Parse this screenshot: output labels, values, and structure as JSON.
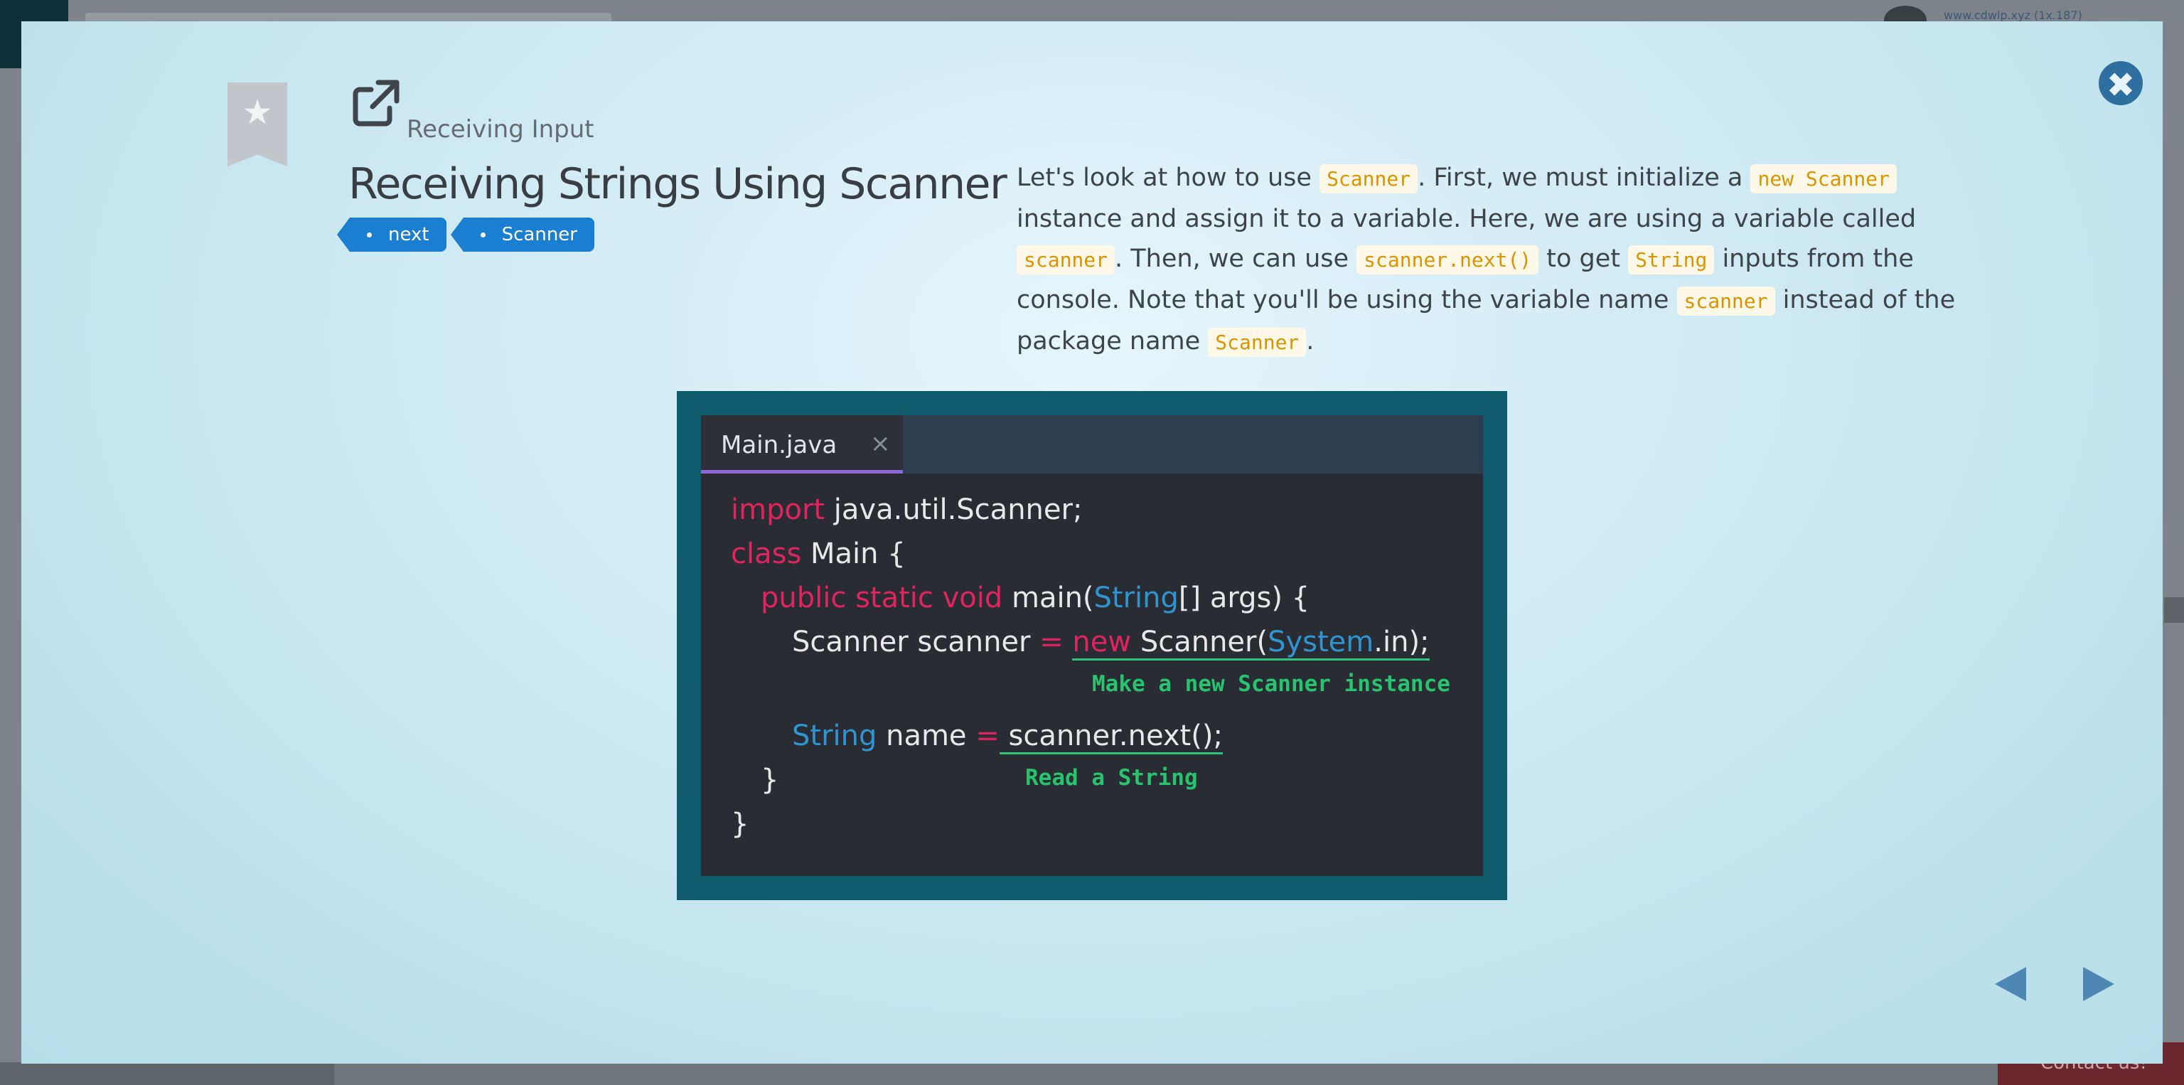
{
  "background": {
    "url_text": "www.cdwlp.xyz (1x.187)",
    "contact_label": "Contact us!"
  },
  "modal": {
    "close_label": "✖",
    "section_title": "Receiving Input",
    "title": "Receiving Strings Using Scanner",
    "tags": [
      "next",
      "Scanner"
    ],
    "description": {
      "t1": "Let's look at how to use ",
      "c1": "Scanner",
      "t2": ". First, we must initialize a ",
      "c2": "new Scanner",
      "t3": " instance and assign it to a variable. Here, we are using a variable called ",
      "c3": "scanner",
      "t4": ". Then, we can use ",
      "c4": "scanner.next()",
      "t5": " to get ",
      "c5": "String",
      "t6": " inputs from the console. Note that you'll be using the variable name ",
      "c6": "scanner",
      "t7": " instead of the package name ",
      "c7": "Scanner",
      "t8": "."
    },
    "illustration": {
      "file_tab": "Main.java",
      "tab_close": "×",
      "code": {
        "l1_kw": "import",
        "l1_rest": " java.util.Scanner;",
        "l2_kw": "class",
        "l2_rest": " Main {",
        "l3_kw": "public static void",
        "l3_a": " main(",
        "l3_ty": "String",
        "l3_b": "[] args) {",
        "l4_a": "Scanner scanner ",
        "l4_eq": "=",
        "l4_sp": " ",
        "l4_new": "new",
        "l4_b": " Scanner(",
        "l4_ty": "System",
        "l4_c": ".in);",
        "l5_ty": "String",
        "l5_a": " name ",
        "l5_eq": "=",
        "l5_b": " scanner.next();",
        "l6": "}",
        "l7": "}"
      },
      "note1": "Make a new Scanner instance",
      "note2": "Read a String"
    }
  }
}
